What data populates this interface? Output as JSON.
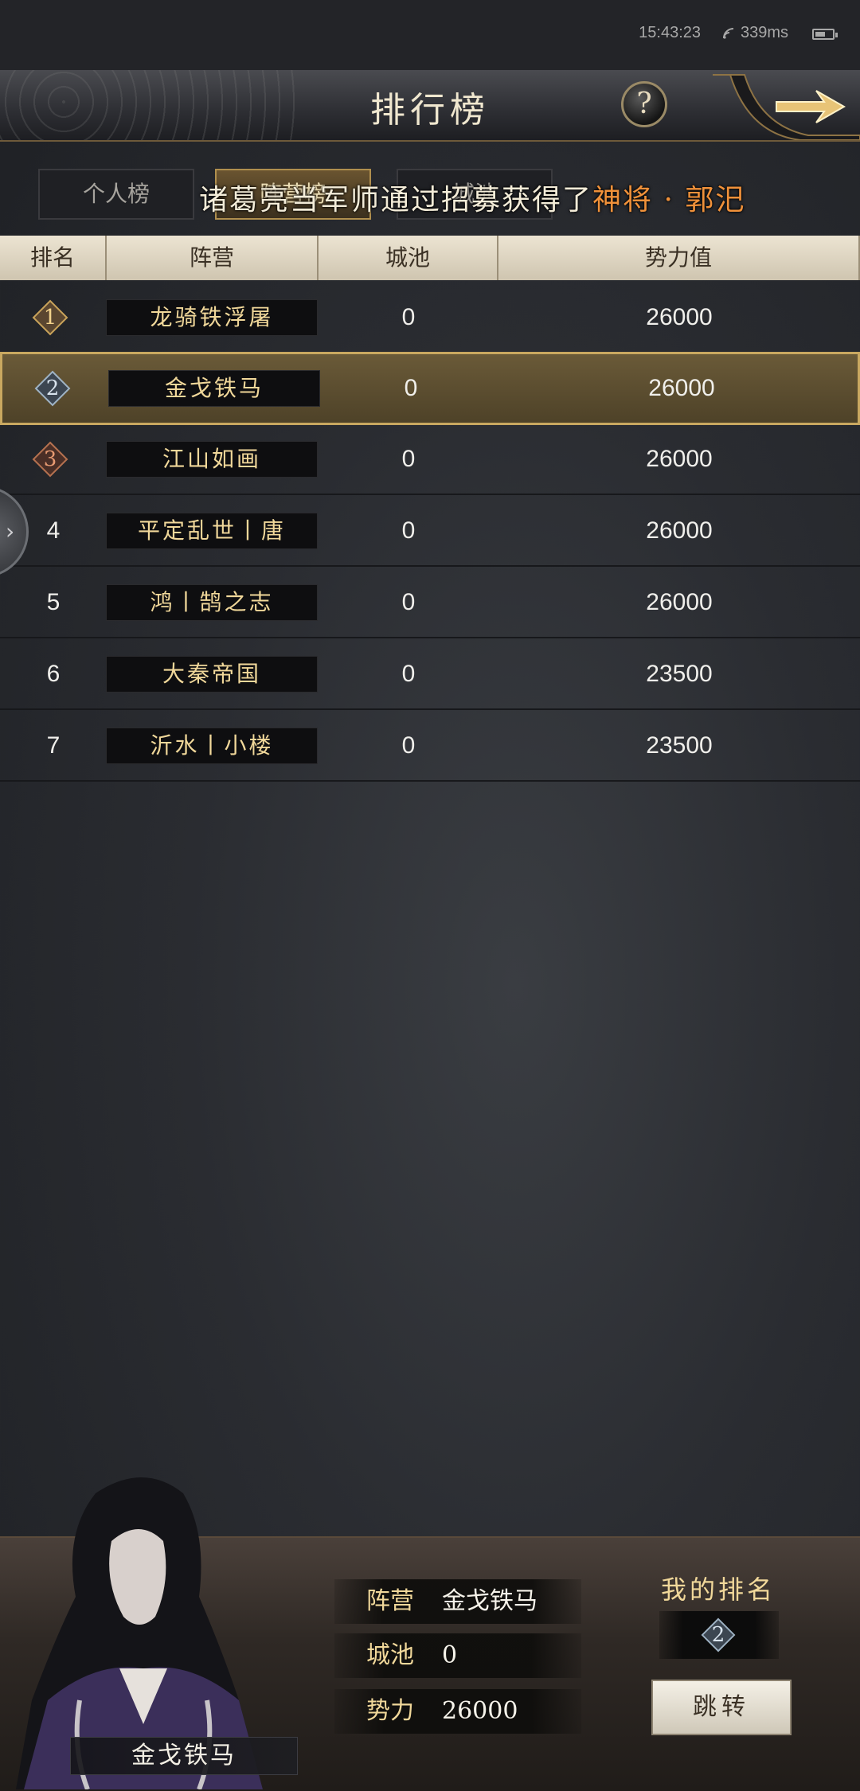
{
  "status_bar": {
    "time": "15:43:23",
    "ping": "339ms"
  },
  "header": {
    "title": "排行榜",
    "help_label": "?"
  },
  "tabs": [
    {
      "label": "个人榜",
      "active": false
    },
    {
      "label": "阵营榜",
      "active": true
    },
    {
      "label": "城池",
      "active": false
    }
  ],
  "ticker": {
    "prefix": "诸葛亮当军师通过招募获得了",
    "highlight": "神将 · 郭汜"
  },
  "table": {
    "columns": [
      "排名",
      "阵营",
      "城池",
      "势力值"
    ],
    "rows": [
      {
        "rank": "1",
        "camp": "龙骑铁浮屠",
        "cities": "0",
        "power": "26000"
      },
      {
        "rank": "2",
        "camp": "金戈铁马",
        "cities": "0",
        "power": "26000"
      },
      {
        "rank": "3",
        "camp": "江山如画",
        "cities": "0",
        "power": "26000"
      },
      {
        "rank": "4",
        "camp": "平定乱世丨唐",
        "cities": "0",
        "power": "26000"
      },
      {
        "rank": "5",
        "camp": "鸿丨鹄之志",
        "cities": "0",
        "power": "26000"
      },
      {
        "rank": "6",
        "camp": "大秦帝国",
        "cities": "0",
        "power": "23500"
      },
      {
        "rank": "7",
        "camp": "沂水丨小楼",
        "cities": "0",
        "power": "23500"
      }
    ]
  },
  "footer": {
    "portrait_name": "金戈铁马",
    "camp_label": "阵营",
    "camp_value": "金戈铁马",
    "cities_label": "城池",
    "cities_value": "0",
    "power_label": "势力",
    "power_value": "26000",
    "my_rank_title": "我的排名",
    "my_rank_value": "2",
    "jump_label": "跳转"
  },
  "colors": {
    "gold": "#f1d89a",
    "highlight_row": "#6a5a38",
    "ticker_highlight": "#f0913a"
  }
}
